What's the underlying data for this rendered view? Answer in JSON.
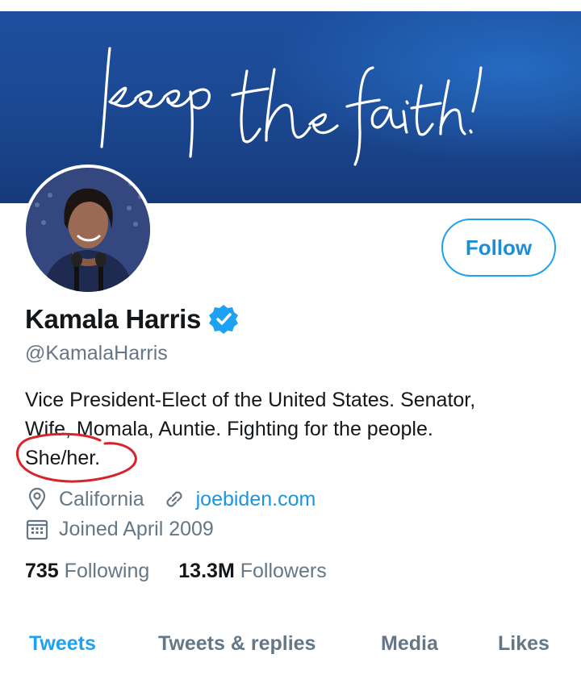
{
  "banner": {
    "handwritten_text": "keep the faith!"
  },
  "profile": {
    "name": "Kamala Harris",
    "handle": "@KamalaHarris",
    "verified": true,
    "bio_lines": [
      "Vice President-Elect of the United States. Senator,",
      "Wife, Momala, Auntie. Fighting for the people.",
      "She/her."
    ],
    "location": "California",
    "website": "joebiden.com",
    "joined": "Joined April 2009"
  },
  "actions": {
    "follow_label": "Follow"
  },
  "stats": {
    "following_count": "735",
    "following_label": "Following",
    "followers_count": "13.3M",
    "followers_label": "Followers"
  },
  "tabs": [
    {
      "label": "Tweets",
      "active": true
    },
    {
      "label": "Tweets & replies",
      "active": false
    },
    {
      "label": "Media",
      "active": false
    },
    {
      "label": "Likes",
      "active": false
    }
  ],
  "colors": {
    "accent": "#1da1f2",
    "banner": "#1b4790",
    "annotation": "#d8232a",
    "muted": "#657786"
  }
}
